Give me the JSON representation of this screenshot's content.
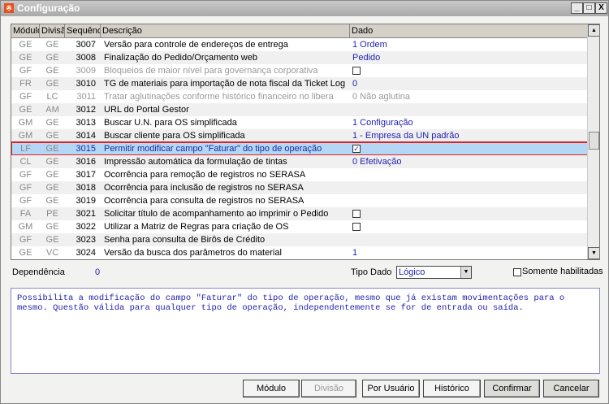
{
  "window": {
    "title": "Configuração",
    "minimize": "_",
    "maximize": "□",
    "close": "X"
  },
  "table": {
    "columns": [
      "Módulo",
      "Divisão",
      "Sequência",
      "Descrição",
      "Dado"
    ],
    "rows": [
      {
        "modulo": "GE",
        "divisao": "GE",
        "seq": "3007",
        "descricao": "Versão para controle de endereços de entrega",
        "dado": "1 Ordem",
        "type": "text"
      },
      {
        "modulo": "GE",
        "divisao": "GE",
        "seq": "3008",
        "descricao": "Finalização do Pedido/Orçamento web",
        "dado": "Pedido",
        "type": "text"
      },
      {
        "modulo": "GF",
        "divisao": "GE",
        "seq": "3009",
        "descricao": "Bloqueios de maior nível para governança corporativa",
        "dado": "",
        "type": "checkbox",
        "checked": false,
        "disabled": true
      },
      {
        "modulo": "FR",
        "divisao": "GE",
        "seq": "3010",
        "descricao": "TG de materiais para importação de nota fiscal da Ticket Log",
        "dado": "0",
        "type": "text"
      },
      {
        "modulo": "GF",
        "divisao": "LC",
        "seq": "3011",
        "descricao": "Tratar aglutinações conforme histórico financeiro no libera",
        "dado": "0 Não aglutina",
        "type": "text",
        "disabled": true
      },
      {
        "modulo": "GE",
        "divisao": "AM",
        "seq": "3012",
        "descricao": "URL do Portal Gestor",
        "dado": "",
        "type": "text"
      },
      {
        "modulo": "GM",
        "divisao": "GE",
        "seq": "3013",
        "descricao": "Buscar U.N. para OS simplificada",
        "dado": "1 Configuração",
        "type": "text"
      },
      {
        "modulo": "GM",
        "divisao": "GE",
        "seq": "3014",
        "descricao": "Buscar cliente para OS simplificada",
        "dado": "1 - Empresa da UN padrão",
        "type": "text"
      },
      {
        "modulo": "LF",
        "divisao": "GE",
        "seq": "3015",
        "descricao": "Permitir modificar campo \"Faturar\" do tipo de operação",
        "dado": "",
        "type": "checkbox",
        "checked": true,
        "selected": true
      },
      {
        "modulo": "CL",
        "divisao": "GE",
        "seq": "3016",
        "descricao": "Impressão automática da formulação de tintas",
        "dado": "0 Efetivação",
        "type": "text"
      },
      {
        "modulo": "GF",
        "divisao": "GE",
        "seq": "3017",
        "descricao": "Ocorrência para remoção de registros no SERASA",
        "dado": "",
        "type": "text"
      },
      {
        "modulo": "GF",
        "divisao": "GE",
        "seq": "3018",
        "descricao": "Ocorrência para inclusão de registros no SERASA",
        "dado": "",
        "type": "text"
      },
      {
        "modulo": "GF",
        "divisao": "GE",
        "seq": "3019",
        "descricao": "Ocorrência para consulta de registros no SERASA",
        "dado": "",
        "type": "text"
      },
      {
        "modulo": "FA",
        "divisao": "PE",
        "seq": "3021",
        "descricao": "Solicitar título de acompanhamento ao imprimir o Pedido",
        "dado": "",
        "type": "checkbox",
        "checked": false
      },
      {
        "modulo": "GM",
        "divisao": "GE",
        "seq": "3022",
        "descricao": "Utilizar a Matriz de Regras para criação de OS",
        "dado": "",
        "type": "checkbox",
        "checked": false
      },
      {
        "modulo": "GF",
        "divisao": "GE",
        "seq": "3023",
        "descricao": "Senha para consulta de Birôs de Crédito",
        "dado": "",
        "type": "text"
      },
      {
        "modulo": "GE",
        "divisao": "VC",
        "seq": "3024",
        "descricao": "Versão da busca dos parâmetros do material",
        "dado": "1",
        "type": "text"
      }
    ]
  },
  "footer": {
    "dependencia_label": "Dependência",
    "dependencia_value": "0",
    "tipo_dado_label": "Tipo Dado",
    "tipo_dado_value": "Lógico",
    "somente_label": "Somente habilitadas",
    "description": "Possibilita a modificação do campo \"Faturar\" do tipo de operação, mesmo que já existam movimentações para o mesmo. Questão válida para qualquer tipo de operação, independentemente se for de entrada ou saída."
  },
  "buttons": {
    "modulo": "Módulo",
    "divisao": "Divisão",
    "por_usuario": "Por Usuário",
    "historico": "Histórico",
    "confirmar": "Confirmar",
    "cancelar": "Cancelar"
  },
  "colors": {
    "accent": "#b5d6f5",
    "highlight": "#e02020",
    "value_text": "#2222b0"
  }
}
